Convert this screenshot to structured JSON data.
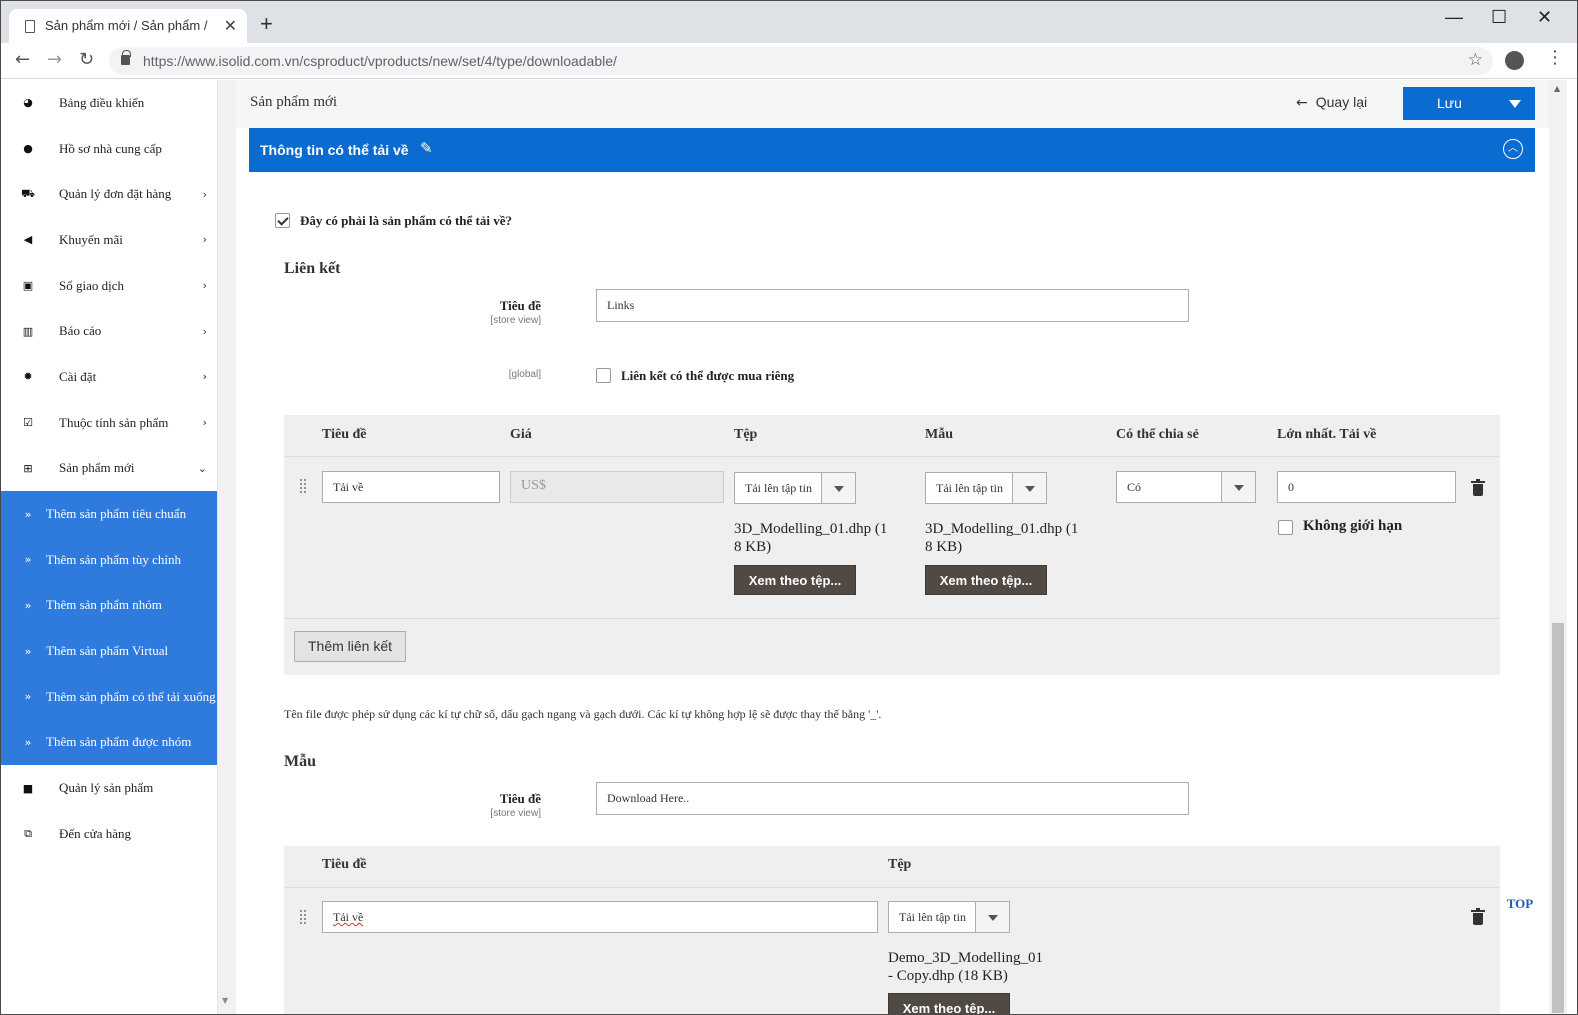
{
  "browser": {
    "tab_title": "Sản phẩm mới / Sản phẩm /",
    "tab_close": "✕",
    "new_tab": "+",
    "url": "https://www.isolid.com.vn/csproduct/vproducts/new/set/4/type/downloadable/",
    "window_controls": [
      "—",
      "☐",
      "✕"
    ],
    "icons": [
      "back-arrow-icon",
      "forward-arrow-icon",
      "reload-icon",
      "lock-icon",
      "star-icon",
      "profile-icon",
      "more-vert-icon"
    ]
  },
  "sidebar": {
    "items": [
      {
        "label": "Bảng điều khiển",
        "icon": "dashboard-icon",
        "glyph": "◕",
        "chevron": ""
      },
      {
        "label": "Hồ sơ nhà cung cấp",
        "icon": "user-icon",
        "glyph": "●",
        "chevron": ""
      },
      {
        "label": "Quản lý đơn đặt hàng",
        "icon": "cart-icon",
        "glyph": "⛟",
        "chevron": "›"
      },
      {
        "label": "Khuyến mãi",
        "icon": "megaphone-icon",
        "glyph": "◀",
        "chevron": "›"
      },
      {
        "label": "Sổ giao dịch",
        "icon": "money-icon",
        "glyph": "▣",
        "chevron": "›"
      },
      {
        "label": "Báo cáo",
        "icon": "bar-chart-icon",
        "glyph": "▥",
        "chevron": "›"
      },
      {
        "label": "Cài đặt",
        "icon": "gear-icon",
        "glyph": "✹",
        "chevron": "›"
      },
      {
        "label": "Thuộc tính sản phẩm",
        "icon": "checkbox-icon",
        "glyph": "☑",
        "chevron": "›"
      },
      {
        "label": "Sản phẩm mới",
        "icon": "plus-square-icon",
        "glyph": "⊞",
        "chevron": "⌄"
      }
    ],
    "subitems": [
      {
        "label": "Thêm sản phẩm tiêu chuẩn",
        "glyph": "»"
      },
      {
        "label": "Thêm sản phẩm tùy chỉnh",
        "glyph": "»"
      },
      {
        "label": "Thêm sản phẩm nhóm",
        "glyph": "»"
      },
      {
        "label": "Thêm sản phẩm Virtual",
        "glyph": "»"
      },
      {
        "label": "Thêm sản phẩm có thể tải xuống",
        "glyph": "»"
      },
      {
        "label": "Thêm sản phẩm được nhóm",
        "glyph": "»"
      }
    ],
    "bottom_items": [
      {
        "label": "Quản lý sản phẩm",
        "icon": "folder-icon",
        "glyph": "■"
      },
      {
        "label": "Đến cửa hàng",
        "icon": "external-link-icon",
        "glyph": "⧉"
      }
    ]
  },
  "header": {
    "page_title": "Sản phẩm mới",
    "back_label": "Quay lại",
    "back_glyph": "←",
    "save_label": "Lưu"
  },
  "section": {
    "title": "Thông tin có thể tải về",
    "edit_glyph": "✎",
    "collapse_glyph": "︿",
    "is_downloadable_label": "Đây có phải là sản phẩm có thể tải về?",
    "is_downloadable_checked": true
  },
  "links": {
    "heading": "Liên kết",
    "title_label": "Tiêu đề",
    "title_scope": "[store view]",
    "title_value": "Links",
    "global_scope": "[global]",
    "separate_label": "Liên kết có thể được mua riêng",
    "separate_checked": false,
    "columns": [
      "Tiêu đề",
      "Giá",
      "Tệp",
      "Mẫu",
      "Có thể chia sẻ",
      "Lớn nhất. Tải về"
    ],
    "row": {
      "title": "Tải về",
      "price_placeholder": "US$",
      "file_select": "Tải lên tập tin",
      "file_name": "3D_Modelling_01.dhp (1",
      "file_name_2": "8 KB)",
      "file_browse": "Xem theo tệp...",
      "sample_select": "Tải lên tập tin",
      "sample_name": "3D_Modelling_01.dhp (1",
      "sample_name_2": "8 KB)",
      "sample_browse": "Xem theo tệp...",
      "shareable": "Có",
      "max_downloads": "0",
      "unlimited_label": "Không giới hạn",
      "unlimited_checked": false
    },
    "add_button": "Thêm liên kết",
    "note": "Tên file được phép sử dụng các kí tự chữ số, dấu gạch ngang và gạch dưới. Các kí tự không hợp lệ sẽ được thay thế bằng '_'."
  },
  "samples": {
    "heading": "Mẫu",
    "title_label": "Tiêu đề",
    "title_scope": "[store view]",
    "title_value": "Download Here..",
    "columns": [
      "Tiêu đề",
      "Tệp"
    ],
    "row": {
      "title": "Tải về",
      "file_select": "Tải lên tập tin",
      "file_name": "Demo_3D_Modelling_01",
      "file_name_2": "- Copy.dhp (18 KB)",
      "file_browse": "Xem theo tệp..."
    }
  },
  "top_link": "TOP"
}
